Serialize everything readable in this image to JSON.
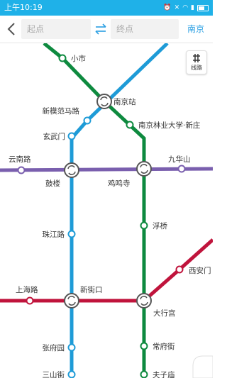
{
  "status": {
    "time": "上午10:19"
  },
  "search": {
    "start_placeholder": "起点",
    "end_placeholder": "终点",
    "city": "南京"
  },
  "map_controls": {
    "lines_button": "线路"
  },
  "line_colors": {
    "line1": "#1e9bd7",
    "line3": "#0e8a3f",
    "line4": "#7a5fae",
    "line2": "#c0143c"
  },
  "stations": {
    "xiaoshi": "小市",
    "nanjing_station": "南京站",
    "xinmofanmalu": "新模范马路",
    "nanjing_forestry": "南京林业大学·新庄",
    "xuanwumen": "玄武门",
    "yunnanlu": "云南路",
    "gulou": "鼓楼",
    "jiminsi": "鸡鸣寺",
    "jiuhuashan": "九华山",
    "fuqiao": "浮桥",
    "zhujianglu": "珠江路",
    "xianmen": "西安门",
    "shanghailu": "上海路",
    "xinjiekou": "新街口",
    "daxinggong": "大行宫",
    "zhangfuyuan": "张府园",
    "changfujie": "常府街",
    "sanshanjie": "三山街",
    "fuzimiao": "夫子庙"
  }
}
